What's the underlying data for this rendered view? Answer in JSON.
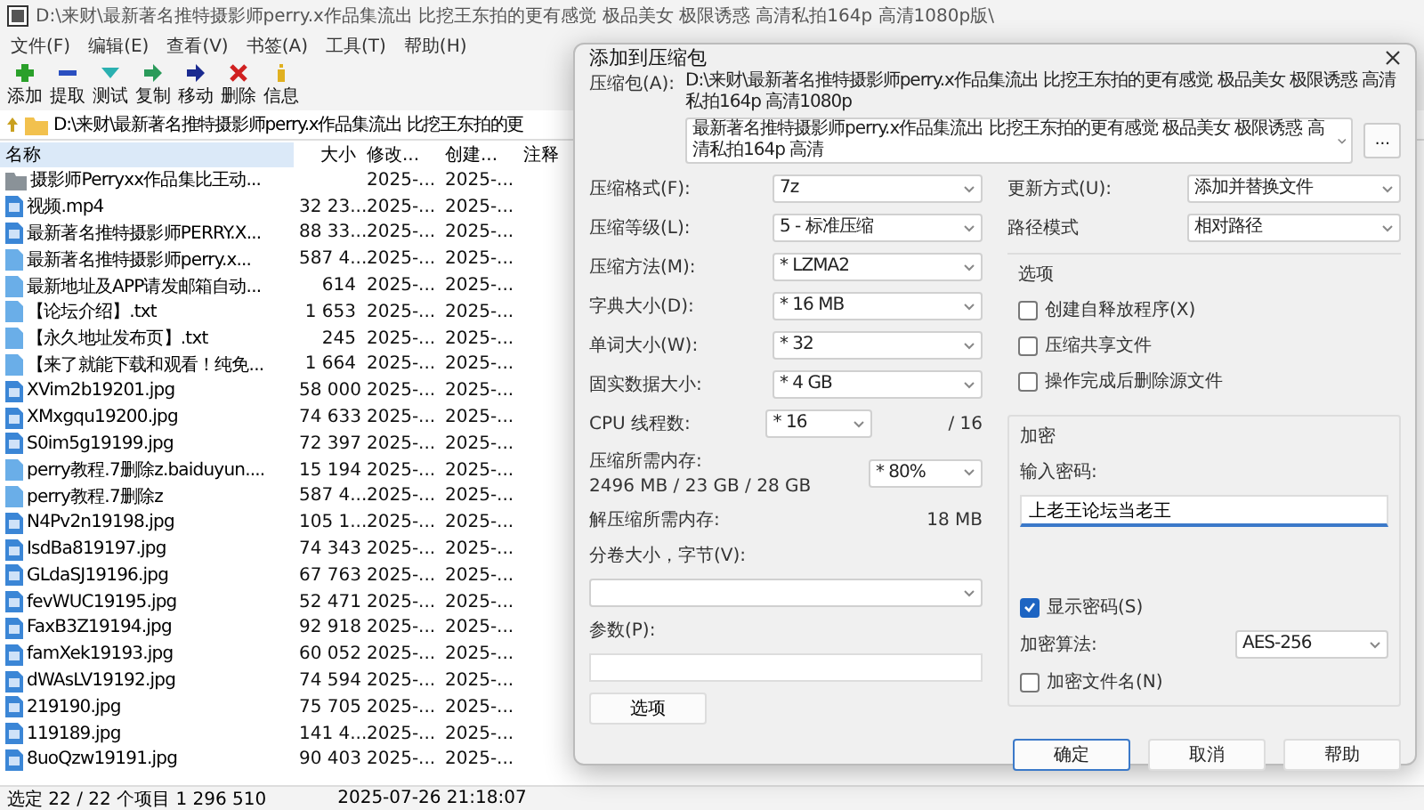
{
  "window": {
    "title": "D:\\来财\\最新著名推特摄影师perry.x作品集流出 比挖王东拍的更有感觉 极品美女 极限诱惑 高清私拍164p 高清1080p版\\"
  },
  "menu": [
    "文件(F)",
    "编辑(E)",
    "查看(V)",
    "书签(A)",
    "工具(T)",
    "帮助(H)"
  ],
  "toolbar": [
    {
      "kind": "add",
      "label": "添加"
    },
    {
      "kind": "extract",
      "label": "提取"
    },
    {
      "kind": "test",
      "label": "测试"
    },
    {
      "kind": "copy",
      "label": "复制"
    },
    {
      "kind": "move",
      "label": "移动"
    },
    {
      "kind": "delete",
      "label": "删除"
    },
    {
      "kind": "info",
      "label": "信息"
    }
  ],
  "address": "D:\\来财\\最新著名推特摄影师perry.x作品集流出 比挖王东拍的更",
  "columns": [
    "名称",
    "大小",
    "修改...",
    "创建...",
    "注释"
  ],
  "files": [
    {
      "kind": "folder",
      "name": "摄影师Perryxx作品集比王动...",
      "modified": "2025-...",
      "created": "2025-..."
    },
    {
      "kind": "media",
      "name": "视频.mp4",
      "size": "32 23...",
      "modified": "2025-...",
      "created": "2025-..."
    },
    {
      "kind": "media",
      "name": "最新著名推特摄影师PERRY.X...",
      "size": "88 33...",
      "modified": "2025-...",
      "created": "2025-..."
    },
    {
      "kind": "document",
      "name": "最新著名推特摄影师perry.x...",
      "size": "587 4...",
      "modified": "2025-...",
      "created": "2025-..."
    },
    {
      "kind": "document",
      "name": "最新地址及APP请发邮箱自动...",
      "size": "614",
      "modified": "2025-...",
      "created": "2025-..."
    },
    {
      "kind": "document",
      "name": "【论坛介绍】.txt",
      "size": "1 653",
      "modified": "2025-...",
      "created": "2025-..."
    },
    {
      "kind": "document",
      "name": "【永久地址发布页】.txt",
      "size": "245",
      "modified": "2025-...",
      "created": "2025-..."
    },
    {
      "kind": "document",
      "name": "【来了就能下载和观看！纯免...",
      "size": "1 664",
      "modified": "2025-...",
      "created": "2025-..."
    },
    {
      "kind": "media",
      "name": "XVim2b19201.jpg",
      "size": "58 000",
      "modified": "2025-...",
      "created": "2025-..."
    },
    {
      "kind": "media",
      "name": "XMxgqu19200.jpg",
      "size": "74 633",
      "modified": "2025-...",
      "created": "2025-..."
    },
    {
      "kind": "media",
      "name": "S0im5g19199.jpg",
      "size": "72 397",
      "modified": "2025-...",
      "created": "2025-..."
    },
    {
      "kind": "document",
      "name": "perry教程.7删除z.baiduyun....",
      "size": "15 194",
      "modified": "2025-...",
      "created": "2025-..."
    },
    {
      "kind": "document",
      "name": "perry教程.7删除z",
      "size": "587 4...",
      "modified": "2025-...",
      "created": "2025-..."
    },
    {
      "kind": "media",
      "name": "N4Pv2n19198.jpg",
      "size": "105 1...",
      "modified": "2025-...",
      "created": "2025-..."
    },
    {
      "kind": "media",
      "name": "IsdBa819197.jpg",
      "size": "74 343",
      "modified": "2025-...",
      "created": "2025-..."
    },
    {
      "kind": "media",
      "name": "GLdaSJ19196.jpg",
      "size": "67 763",
      "modified": "2025-...",
      "created": "2025-..."
    },
    {
      "kind": "media",
      "name": "fevWUC19195.jpg",
      "size": "52 471",
      "modified": "2025-...",
      "created": "2025-..."
    },
    {
      "kind": "media",
      "name": "FaxB3Z19194.jpg",
      "size": "92 918",
      "modified": "2025-...",
      "created": "2025-..."
    },
    {
      "kind": "media",
      "name": "famXek19193.jpg",
      "size": "60 052",
      "modified": "2025-...",
      "created": "2025-..."
    },
    {
      "kind": "media",
      "name": "dWAsLV19192.jpg",
      "size": "74 594",
      "modified": "2025-...",
      "created": "2025-..."
    },
    {
      "kind": "media",
      "name": "219190.jpg",
      "size": "75 705",
      "modified": "2025-...",
      "created": "2025-..."
    },
    {
      "kind": "media",
      "name": "119189.jpg",
      "size": "141 4...",
      "modified": "2025-...",
      "created": "2025-..."
    },
    {
      "kind": "media",
      "name": "8uoQzw19191.jpg",
      "size": "90 403",
      "modified": "2025-...",
      "created": "2025-..."
    }
  ],
  "status_bar": [
    "选定 22 / 22 个项目 1 296 510",
    "2025-07-26 21:18:07"
  ],
  "dialog": {
    "title": "添加到压缩包",
    "archive": {
      "label": "压缩包(A):",
      "path": "D:\\来财\\最新著名推特摄影师perry.x作品集流出 比挖王东拍的更有感觉 极品美女 极限诱惑 高清私拍164p 高清1080p",
      "name": "最新著名推特摄影师perry.x作品集流出 比挖王东拍的更有感觉 极品美女 极限诱惑 高清私拍164p 高清",
      "browse": "..."
    },
    "settings": [
      {
        "label": "压缩格式(F):",
        "value": "7z"
      },
      {
        "label": "压缩等级(L):",
        "value": "5 - 标准压缩"
      },
      {
        "label": "压缩方法(M):",
        "value": "* LZMA2"
      },
      {
        "label": "字典大小(D):",
        "value": "* 16 MB"
      },
      {
        "label": "单词大小(W):",
        "value": "* 32"
      },
      {
        "label": "固实数据大小:",
        "value": "* 4 GB"
      }
    ],
    "threads": {
      "label": "CPU 线程数:",
      "value": "* 16",
      "max": "/ 16"
    },
    "memory": {
      "label": "压缩所需内存:",
      "value": "2496 MB / 23 GB / 28 GB",
      "percent": "* 80%"
    },
    "decompress": {
      "label": "解压缩所需内存:",
      "value": "18 MB"
    },
    "volume": {
      "label": "分卷大小，字节(V):"
    },
    "params": {
      "label": "参数(P):"
    },
    "options_button": "选项",
    "update": {
      "label": "更新方式(U):",
      "value": "添加并替换文件"
    },
    "path_mode": {
      "label": "路径模式",
      "value": "相对路径"
    },
    "options": {
      "title": "选项",
      "items": [
        {
          "label": "创建自释放程序(X)",
          "checked": false
        },
        {
          "label": "压缩共享文件",
          "checked": false
        },
        {
          "label": "操作完成后删除源文件",
          "checked": false
        }
      ]
    },
    "encryption": {
      "title": "加密",
      "password_label": "输入密码:",
      "password": "上老王论坛当老王",
      "show_password": {
        "label": "显示密码(S)",
        "checked": true
      },
      "method": {
        "label": "加密算法:",
        "value": "AES-256"
      },
      "encrypt_names": {
        "label": "加密文件名(N)",
        "checked": false
      }
    },
    "buttons": [
      {
        "label": "确定",
        "default": true
      },
      {
        "label": "取消",
        "default": false
      },
      {
        "label": "帮助",
        "default": false
      }
    ]
  }
}
